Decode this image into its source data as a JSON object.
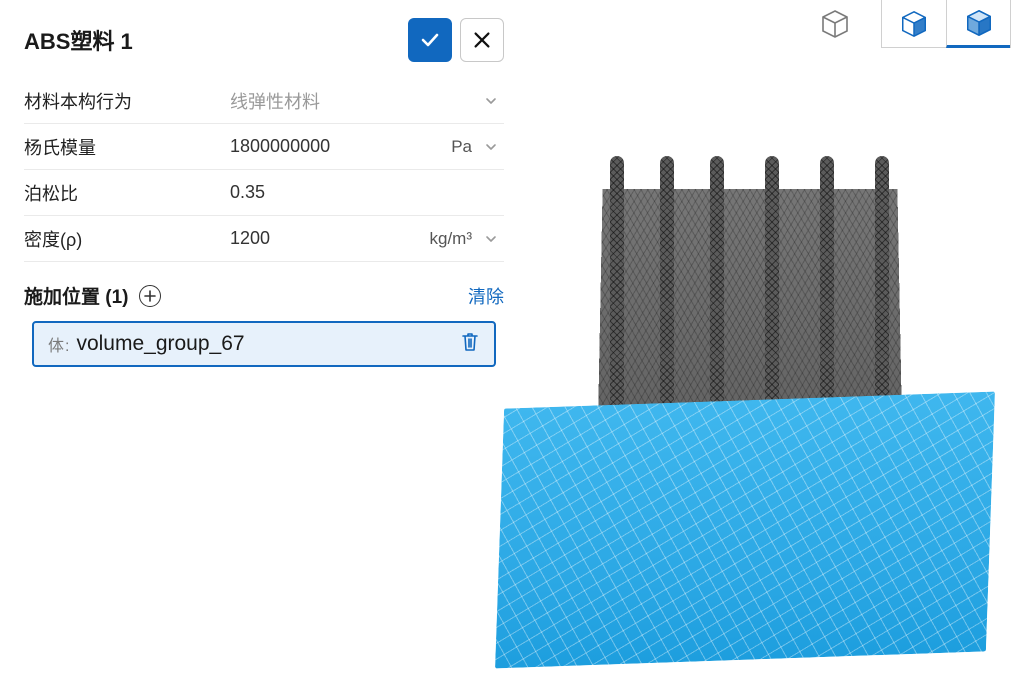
{
  "panel": {
    "title": "ABS塑料 1",
    "properties": [
      {
        "label": "材料本构行为",
        "value": "线弹性材料",
        "muted": true,
        "unit": "",
        "has_dropdown": true
      },
      {
        "label": "杨氏模量",
        "value": "1800000000",
        "muted": false,
        "unit": "Pa",
        "has_dropdown": true
      },
      {
        "label": "泊松比",
        "value": "0.35",
        "muted": false,
        "unit": "",
        "has_dropdown": false
      },
      {
        "label": "密度(ρ)",
        "value": "1200",
        "muted": false,
        "unit": "kg/m³",
        "has_dropdown": true
      }
    ],
    "assignment": {
      "title": "施加位置 (1)",
      "clear_label": "清除",
      "item_prefix": "体:",
      "item_name": "volume_group_67"
    }
  },
  "view_modes": {
    "outline": "wireframe-view",
    "shaded": "shaded-view",
    "shaded_edges": "shaded-edges-view"
  }
}
